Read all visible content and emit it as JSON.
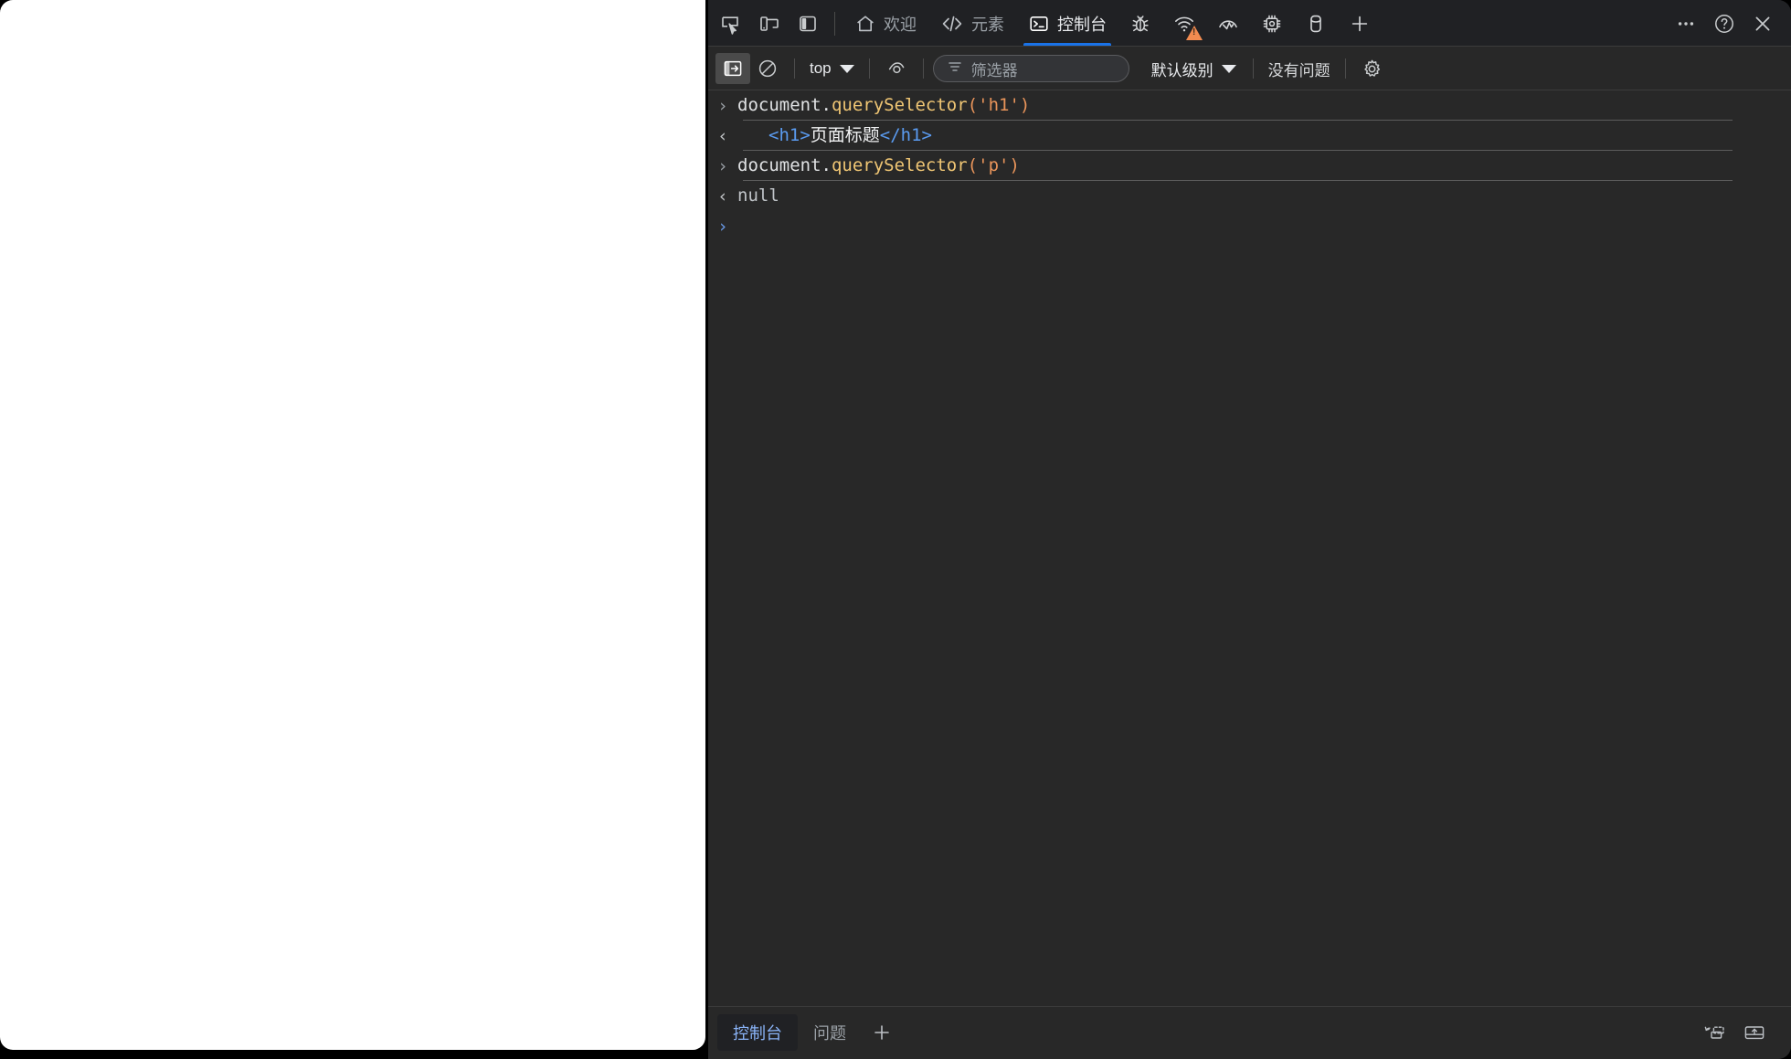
{
  "window": {
    "devtools_theme_bg": "#282828",
    "accent_color": "#1a73e8",
    "warning_color": "#f28b50"
  },
  "tabstrip": {
    "left_tools": [
      {
        "name": "inspect-element-icon",
        "title": "检查元素"
      },
      {
        "name": "device-toolbar-icon",
        "title": "设备模拟"
      },
      {
        "name": "dock-panel-icon",
        "title": "面板停靠"
      }
    ],
    "tabs": [
      {
        "label": "欢迎",
        "icon": "home-icon",
        "active": false
      },
      {
        "label": "元素",
        "icon": "code-brackets-icon",
        "active": false
      },
      {
        "label": "控制台",
        "icon": "console-terminal-icon",
        "active": true
      }
    ],
    "icon_tabs": [
      {
        "name": "debugger-bug-icon",
        "warning": false
      },
      {
        "name": "network-wifi-icon",
        "warning": true
      },
      {
        "name": "performance-gauge-icon",
        "warning": false
      },
      {
        "name": "memory-chip-icon",
        "warning": false
      },
      {
        "name": "application-storage-icon",
        "warning": false
      },
      {
        "name": "add-tab-plus-icon",
        "warning": false
      }
    ],
    "right_tools": [
      {
        "name": "more-options-icon"
      },
      {
        "name": "help-question-icon"
      },
      {
        "name": "close-devtools-icon"
      }
    ]
  },
  "console_toolbar": {
    "sidebar_toggle": {
      "name": "console-sidebar-toggle",
      "toggled": true
    },
    "clear_console": {
      "name": "clear-console-icon"
    },
    "context_selector": {
      "value": "top"
    },
    "live_expression": {
      "name": "eye-live-expression-icon"
    },
    "filter": {
      "placeholder": "筛选器",
      "value": ""
    },
    "log_level": {
      "value": "默认级别"
    },
    "issues_status": "没有问题",
    "settings": {
      "name": "console-settings-gear-icon"
    }
  },
  "console_entries": [
    {
      "type": "input",
      "marker": "›",
      "tokens": [
        {
          "text": "document.",
          "cls": "tok-plain"
        },
        {
          "text": "querySelector",
          "cls": "tok-fn"
        },
        {
          "text": "(",
          "cls": "tok-punc"
        },
        {
          "text": "'h1'",
          "cls": "tok-str"
        },
        {
          "text": ")",
          "cls": "tok-punc"
        }
      ],
      "plain": "document.querySelector('h1')"
    },
    {
      "type": "output",
      "marker": "‹",
      "tokens": [
        {
          "text": "    ",
          "cls": "tok-plain"
        },
        {
          "text": "<h1>",
          "cls": "tok-tag"
        },
        {
          "text": "页面标题",
          "cls": "tok-text"
        },
        {
          "text": "</h1>",
          "cls": "tok-tag"
        }
      ],
      "plain": "<h1>页面标题</h1>"
    },
    {
      "type": "input",
      "marker": "›",
      "tokens": [
        {
          "text": "document.",
          "cls": "tok-plain"
        },
        {
          "text": "querySelector",
          "cls": "tok-fn"
        },
        {
          "text": "(",
          "cls": "tok-punc"
        },
        {
          "text": "'p'",
          "cls": "tok-str"
        },
        {
          "text": ")",
          "cls": "tok-punc"
        }
      ],
      "plain": "document.querySelector('p')"
    },
    {
      "type": "output",
      "marker": "‹",
      "tokens": [
        {
          "text": "null",
          "cls": "tok-null"
        }
      ],
      "plain": "null"
    }
  ],
  "console_prompt": {
    "marker": "›",
    "value": ""
  },
  "drawer": {
    "tabs": [
      {
        "label": "控制台",
        "active": true
      },
      {
        "label": "问题",
        "active": false
      }
    ],
    "add_tab_label": "+",
    "right_icons": [
      {
        "name": "restore-drawer-icon"
      },
      {
        "name": "dock-to-bottom-icon"
      }
    ]
  },
  "page": {
    "background": "#ffffff"
  }
}
